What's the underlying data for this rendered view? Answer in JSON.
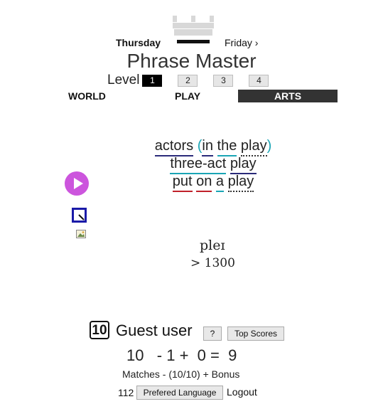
{
  "header": {
    "day_current": "Thursday",
    "day_next": "Friday ›",
    "title": "Phrase Master"
  },
  "levels": {
    "label": "Level",
    "items": [
      "1",
      "2",
      "3",
      "4"
    ],
    "active": "1"
  },
  "nav": {
    "world": "WORLD",
    "play": "PLAY",
    "arts": "ARTS",
    "active": "ARTS"
  },
  "phrases": {
    "line1": {
      "w1": "actors",
      "p_open": "(",
      "w2": "in",
      "w3": "the",
      "w4": "play",
      "p_close": ")"
    },
    "line2": {
      "w1": "three-act",
      "w2": "play"
    },
    "line3": {
      "w1": "put",
      "w2": "on",
      "w3": "a",
      "w4": "play"
    }
  },
  "icons": {
    "play": "play-circle-icon",
    "edit": "square-edit-icon",
    "image": "image-icon",
    "crown": "crown-icon"
  },
  "pronunciation": {
    "text": "pleɪ",
    "arrow": ">",
    "score": "1300"
  },
  "footer": {
    "score": "10",
    "user": "Guest user",
    "help_label": "?",
    "top_scores_label": "Top Scores",
    "equation": "10   - 1 +  0 =  9",
    "matches": "Matches - (10/10) + Bonus",
    "user_count": "112",
    "language_label": "Prefered Language",
    "logout_label": "Logout"
  },
  "colors": {
    "play_button": "#cc55dd",
    "active_tab": "#333333",
    "edit_border": "#1a1aa8",
    "underline_teal": "#1aa5b5",
    "underline_red": "#c0202a",
    "underline_navy": "#2b2b7a"
  }
}
